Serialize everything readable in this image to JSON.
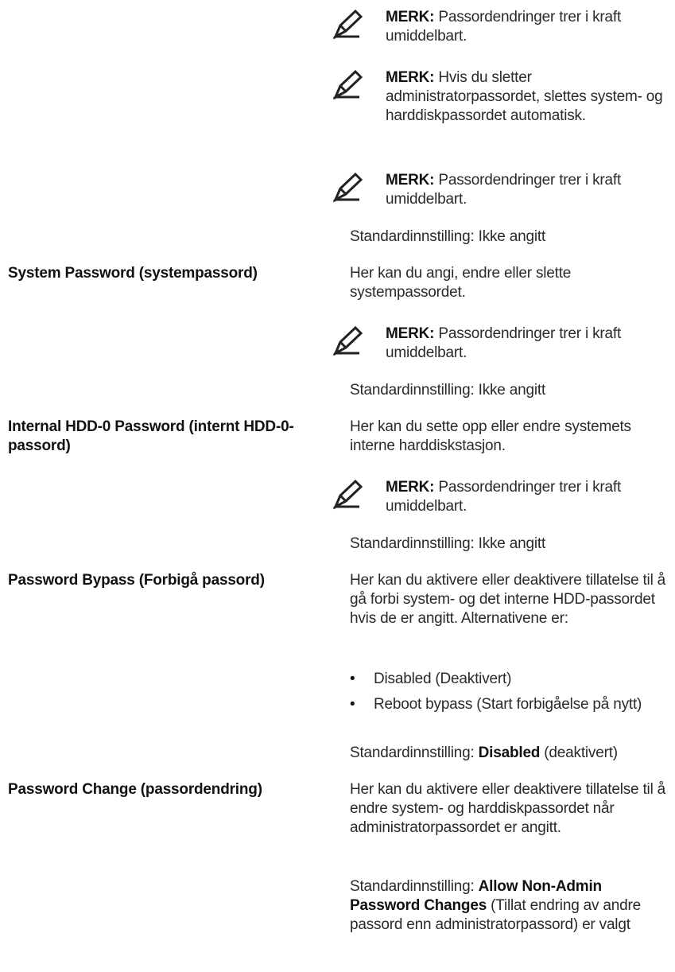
{
  "note_prefix": "MERK:",
  "top_notes": [
    {
      "text": " Passordendringer trer i kraft umiddelbart."
    },
    {
      "text": " Hvis du sletter administratorpassordet, slettes system- og harddiskpassordet automatisk."
    },
    {
      "text": " Passordendringer trer i kraft umiddelbart."
    }
  ],
  "top_default": "Standardinnstilling: Ikke angitt",
  "sections": [
    {
      "label": "System Password (systempassord)",
      "description": "Her kan du angi, endre eller slette systempassordet.",
      "note": " Passordendringer trer i kraft umiddelbart.",
      "default": "Standardinnstilling: Ikke angitt"
    },
    {
      "label": "Internal HDD-0 Password (internt HDD-0-passord)",
      "description": "Her kan du sette opp eller endre systemets interne harddiskstasjon.",
      "note": " Passordendringer trer i kraft umiddelbart.",
      "default": "Standardinnstilling: Ikke angitt"
    },
    {
      "label": "Password Bypass (Forbigå passord)",
      "description": "Her kan du aktivere eller deaktivere tillatelse til å gå forbi system- og det interne HDD-passordet hvis de er angitt. Alternativene er:",
      "options": [
        "Disabled (Deaktivert)",
        "Reboot bypass (Start forbigåelse på nytt)"
      ],
      "default_prefix": "Standardinnstilling: ",
      "default_bold": "Disabled",
      "default_suffix": " (deaktivert)"
    },
    {
      "label": "Password Change (passordendring)",
      "description": "Her kan du aktivere eller deaktivere tillatelse til å endre system- og harddiskpassordet når administratorpassordet er angitt.",
      "default_prefix": "Standardinnstilling: ",
      "default_bold": "Allow Non-Admin Password Changes",
      "default_suffix": " (Tillat endring av andre passord enn administratorpassord) er valgt"
    }
  ],
  "bullet_glyph": "•",
  "icon": "pencil-note-icon"
}
